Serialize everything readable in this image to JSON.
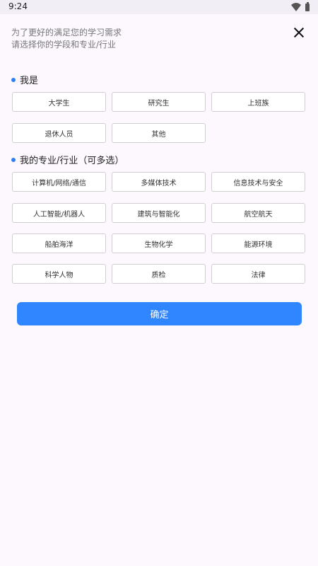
{
  "status_bar": {
    "time": "9:24"
  },
  "intro": {
    "line1": "为了更好的满足您的学习需求",
    "line2": "请选择你的学段和专业/行业"
  },
  "section_identity": {
    "title": "我是",
    "options": [
      "大学生",
      "研究生",
      "上班族",
      "退休人员",
      "其他"
    ]
  },
  "section_major": {
    "title": "我的专业/行业（可多选）",
    "options": [
      "计算机/网络/通信",
      "多媒体技术",
      "信息技术与安全",
      "人工智能/机器人",
      "建筑与智能化",
      "航空航天",
      "船舶海洋",
      "生物化学",
      "能源环境",
      "科学人物",
      "质检",
      "法律"
    ]
  },
  "confirm": {
    "label": "确定"
  },
  "colors": {
    "accent": "#2f86ff",
    "dot": "#2f7ff4",
    "background": "#fcf8fe"
  }
}
